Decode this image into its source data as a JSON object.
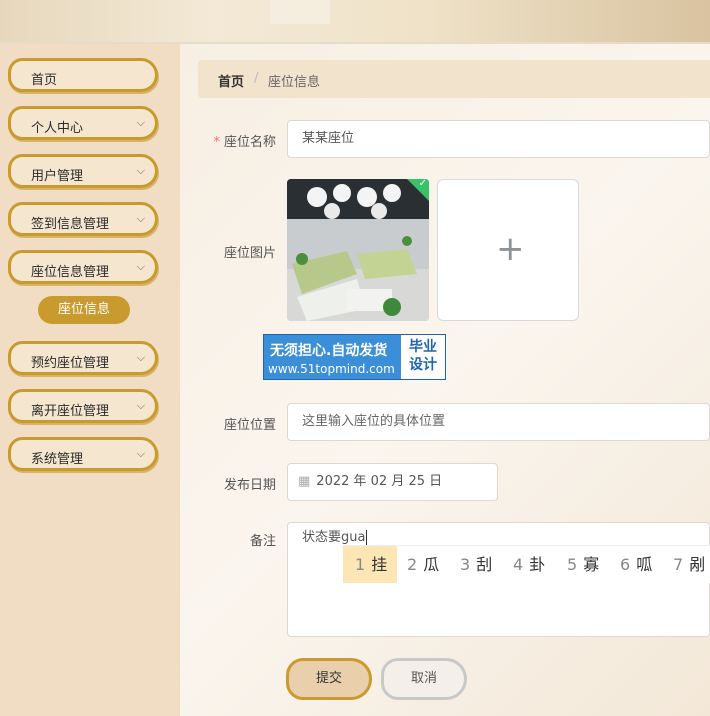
{
  "sidebar": {
    "items": [
      {
        "label": "首页",
        "has_children": false
      },
      {
        "label": "个人中心",
        "has_children": true
      },
      {
        "label": "用户管理",
        "has_children": true
      },
      {
        "label": "签到信息管理",
        "has_children": true
      },
      {
        "label": "座位信息管理",
        "has_children": true
      },
      {
        "label": "预约座位管理",
        "has_children": true
      },
      {
        "label": "离开座位管理",
        "has_children": true
      },
      {
        "label": "系统管理",
        "has_children": true
      }
    ],
    "active_submenu": "座位信息",
    "chevron": "chevron-down-icon"
  },
  "breadcrumb": {
    "home": "首页",
    "separator": "/",
    "current": "座位信息"
  },
  "form": {
    "name_label": "座位名称",
    "name_value": "某某座位",
    "image_label": "座位图片",
    "location_label": "座位位置",
    "location_placeholder": "这里输入座位的具体位置",
    "date_label": "发布日期",
    "date_value": "2022 年 02 月 25 日",
    "remark_label": "备注",
    "remark_value": "状态要gua"
  },
  "ime": {
    "candidates": [
      {
        "num": "1",
        "text": "挂"
      },
      {
        "num": "2",
        "text": "瓜"
      },
      {
        "num": "3",
        "text": "刮"
      },
      {
        "num": "4",
        "text": "卦"
      },
      {
        "num": "5",
        "text": "寡"
      },
      {
        "num": "6",
        "text": "呱"
      },
      {
        "num": "7",
        "text": "剐"
      }
    ]
  },
  "watermark": {
    "line1": "无须担心.自动发货",
    "line2": "www.51topmind.com",
    "box1": "毕业",
    "box2": "设计"
  },
  "buttons": {
    "submit": "提交",
    "cancel": "取消"
  },
  "colors": {
    "accent": "#c99a2e",
    "sidebar_bg": "#f0ddc3",
    "required": "#f56c6c",
    "check": "#3cc16b"
  }
}
